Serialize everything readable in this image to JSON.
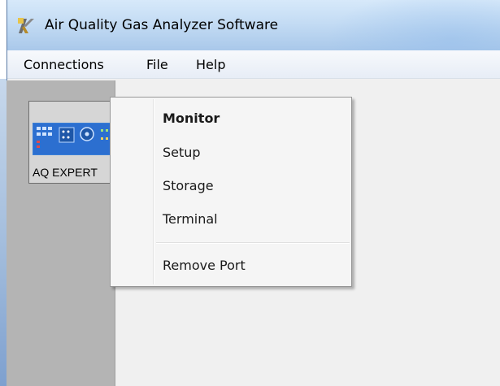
{
  "window": {
    "title": "Air Quality Gas Analyzer Software",
    "icon": "app-logo-icon"
  },
  "menubar": {
    "items": [
      {
        "label": "Connections"
      },
      {
        "label": "File"
      },
      {
        "label": "Help"
      }
    ]
  },
  "device": {
    "label": "AQ EXPERT",
    "icon": "device-panel-icon"
  },
  "context_menu": {
    "items": [
      {
        "label": "Monitor",
        "default": true
      },
      {
        "label": "Setup"
      },
      {
        "label": "Storage"
      },
      {
        "label": "Terminal"
      },
      {
        "label": "Remove Port"
      }
    ]
  },
  "colors": {
    "title_gradient_top": "#d7e9fa",
    "title_gradient_bottom": "#a9c8ea",
    "panel_gray": "#b4b4b4",
    "menu_bg": "#f5f5f5",
    "device_blue": "#2c6fd0"
  }
}
